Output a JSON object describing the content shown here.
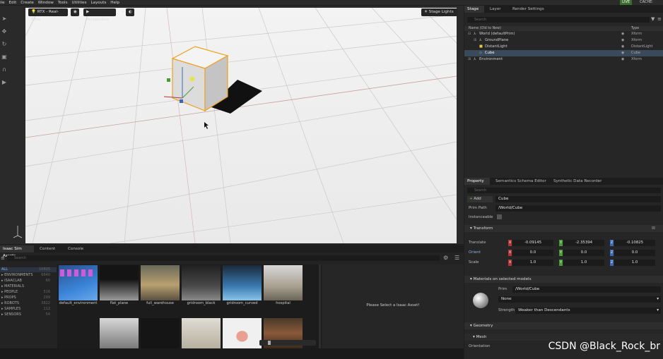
{
  "menubar": {
    "items": [
      "ile",
      "Edit",
      "Create",
      "Window",
      "Tools",
      "Utilities",
      "Layouts",
      "Help"
    ],
    "live": "LIVE",
    "cache": "CACHE:"
  },
  "viewport": {
    "renderer": "RTX - Real-Time",
    "camera": "Perspective",
    "stage_lights": "Stage Lights"
  },
  "stage": {
    "tabs": [
      "Stage",
      "Layer",
      "Render Settings"
    ],
    "search_placeholder": "Search",
    "col_name": "Name (Old to New)",
    "col_type": "Type",
    "rows": [
      {
        "name": "World (defaultPrim)",
        "type": "Xform"
      },
      {
        "name": "GroundPlane",
        "type": "Xform"
      },
      {
        "name": "DistantLight",
        "type": "DistantLight"
      },
      {
        "name": "Cube",
        "type": "Cube"
      },
      {
        "name": "Environment",
        "type": "Xform"
      }
    ]
  },
  "property": {
    "tabs": [
      "Property",
      "Semantics Schema Editor",
      "Synthetic Data Recorder"
    ],
    "search_placeholder": "Search",
    "add": "Add",
    "name_value": "Cube",
    "prim_path_label": "Prim Path",
    "prim_path": "/World/Cube",
    "instanceable_label": "Instanceable",
    "transform_label": "Transform",
    "translate_label": "Translate",
    "orient_label": "Orient",
    "scale_label": "Scale",
    "translate": [
      "-0.09145",
      "-2.35394",
      "-0.10825"
    ],
    "orient": [
      "0.0",
      "0.0",
      "0.0"
    ],
    "scale": [
      "1.0",
      "1.0",
      "1.0"
    ],
    "materials_label": "Materials on selected models",
    "prim_label": "Prim",
    "material_prim": "/World/Cube",
    "material_value": "None",
    "strength_label": "Strength",
    "strength_value": "Weaker than Descendants",
    "geometry_label": "Geometry",
    "mesh_label": "Mesh",
    "orientation_label": "Orientation"
  },
  "assets": {
    "tabs": [
      "Isaac Sim Assets",
      "Content",
      "Console"
    ],
    "search_placeholder": "Search",
    "categories": [
      {
        "name": "ALL",
        "count": "10805"
      },
      {
        "name": "ENVIRONMENTS",
        "count": "6640"
      },
      {
        "name": "ISAACLAB",
        "count": "60"
      },
      {
        "name": "MATERIALS",
        "count": ""
      },
      {
        "name": "PEOPLE",
        "count": "516"
      },
      {
        "name": "PROPS",
        "count": "299"
      },
      {
        "name": "ROBOTS",
        "count": "3822"
      },
      {
        "name": "SAMPLES",
        "count": "112"
      },
      {
        "name": "SENSORS",
        "count": "54"
      }
    ],
    "thumbnails": [
      "default_environment",
      "flat_plane",
      "full_warehouse",
      "gridroom_black",
      "gridroom_curved",
      "hospital"
    ],
    "placeholder_text": "Please Select a Isaac Asset!"
  },
  "watermark": "CSDN @Black_Rock_br"
}
